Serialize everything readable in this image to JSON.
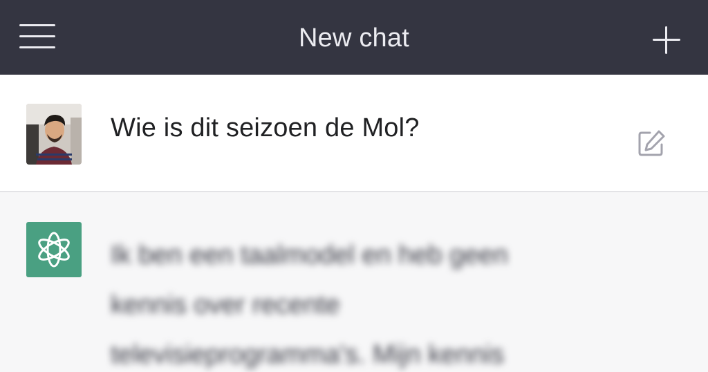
{
  "header": {
    "title": "New chat",
    "menu_icon": "hamburger-menu-icon",
    "new_chat_icon": "plus-icon"
  },
  "user_message": {
    "avatar": "user-avatar",
    "text": "Wie is dit seizoen de Mol?",
    "edit_icon": "edit-icon"
  },
  "assistant_message": {
    "avatar": "chatgpt-logo-icon",
    "lines": [
      "Ik ben een taalmodel en heb geen",
      "kennis over recente",
      "televisieprogramma's. Mijn kennis"
    ],
    "blurred": true
  },
  "colors": {
    "topbar": "#343541",
    "brand_green": "#4aa082",
    "user_bg": "#ffffff",
    "assistant_bg": "#f7f7f8"
  }
}
